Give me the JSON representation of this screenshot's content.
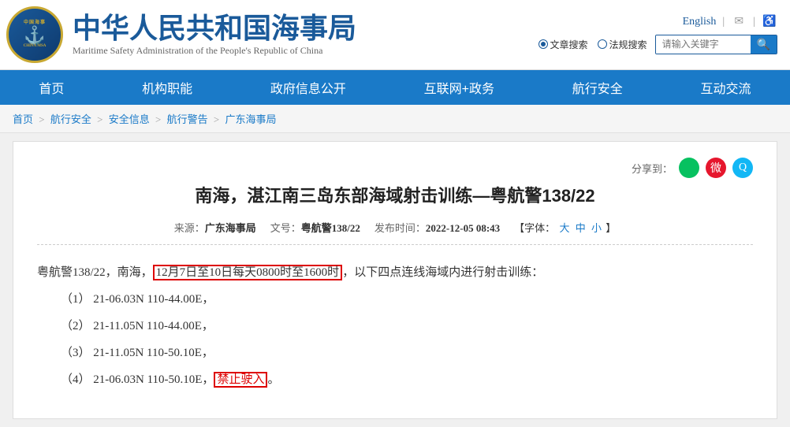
{
  "header": {
    "logo_text_top": "中国海事",
    "logo_text_bottom": "CHINA MSA",
    "title_cn": "中华人民共和国海事局",
    "title_en": "Maritime Safety Administration of the People's Republic of China",
    "lang_label": "English",
    "search_placeholder": "请输入关键字",
    "radio_options": [
      "文章搜索",
      "法规搜索"
    ]
  },
  "nav": {
    "items": [
      "首页",
      "机构职能",
      "政府信息公开",
      "互联网+政务",
      "航行安全",
      "互动交流"
    ]
  },
  "breadcrumb": {
    "items": [
      "首页",
      "航行安全",
      "安全信息",
      "航行警告",
      "广东海事局"
    ]
  },
  "share": {
    "label": "分享到："
  },
  "article": {
    "title": "南海，湛江南三岛东部海域射击训练—粤航警138/22",
    "source_label": "来源：",
    "source": "广东海事局",
    "doc_no_label": "文号：",
    "doc_no": "粤航警138/22",
    "pub_time_label": "发布时间：",
    "pub_time": "2022-12-05 08:43",
    "font_label": "【字体：",
    "font_sizes": [
      "大",
      "中",
      "小"
    ],
    "body_intro": "粤航警138/22，南海，",
    "body_highlighted": "12月7日至10日每天0800时至1600时",
    "body_after": "，以下四点连线海域内进行射击训练：",
    "points": [
      "（1）  21-06.03N  110-44.00E，",
      "（2）  21-11.05N  110-44.00E，",
      "（3）  21-11.05N  110-50.10E，",
      "（4）  21-06.03N  110-50.10E，"
    ],
    "last_point_suffix": "禁止驶入",
    "last_point_suffix_punctuation": "。"
  }
}
